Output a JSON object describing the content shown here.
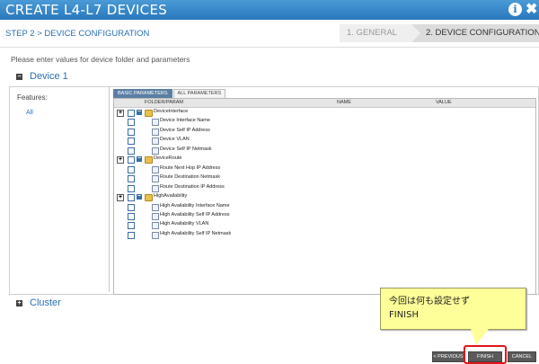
{
  "titlebar": {
    "title": "CREATE L4-L7 DEVICES",
    "info_icon": "i",
    "close_icon": "✖"
  },
  "step": {
    "label": "STEP 2 > DEVICE CONFIGURATION"
  },
  "wizard": [
    {
      "label": "1. GENERAL"
    },
    {
      "label": "2. DEVICE CONFIGURATION"
    }
  ],
  "intro": "Please enter values for device folder and parameters",
  "device_section": {
    "title": "Device 1",
    "toggle": "−"
  },
  "features": {
    "label": "Features:",
    "items": [
      "All"
    ]
  },
  "tabs": [
    {
      "label": "BASIC PARAMETERS"
    },
    {
      "label": "ALL PARAMETERS"
    }
  ],
  "grid": {
    "headers": [
      "FOLDER/PARAM",
      "NAME",
      "VALUE"
    ],
    "rows": [
      {
        "type": "folder",
        "label": "DeviceInterface"
      },
      {
        "type": "param",
        "label": "Device Interface Name"
      },
      {
        "type": "param",
        "label": "Device Self IP Address"
      },
      {
        "type": "param",
        "label": "Device VLAN"
      },
      {
        "type": "param",
        "label": "Device Self IP Netmask"
      },
      {
        "type": "folder",
        "label": "DeviceRoute"
      },
      {
        "type": "param",
        "label": "Route Next Hop IP Address"
      },
      {
        "type": "param",
        "label": "Route Destination Netmask"
      },
      {
        "type": "param",
        "label": "Route Destination IP Address"
      },
      {
        "type": "folder",
        "label": "HighAvailability"
      },
      {
        "type": "param",
        "label": "High Availability Interface Name"
      },
      {
        "type": "param",
        "label": "High Availability Self IP Address"
      },
      {
        "type": "param",
        "label": "High Availability VLAN"
      },
      {
        "type": "param",
        "label": "High Availability Self IP Netmask"
      }
    ]
  },
  "cluster_section": {
    "title": "Cluster",
    "toggle": "+"
  },
  "callout": {
    "line1": "今回は何も設定せず",
    "line2": "FINISH"
  },
  "buttons": {
    "previous": "< PREVIOUS",
    "finish": "FINISH",
    "cancel": "CANCEL"
  },
  "colors": {
    "titlebar": "#2a78bd",
    "accent": "#2a6fb5",
    "highlight": "#e0161b",
    "callout": "#ffff99"
  }
}
